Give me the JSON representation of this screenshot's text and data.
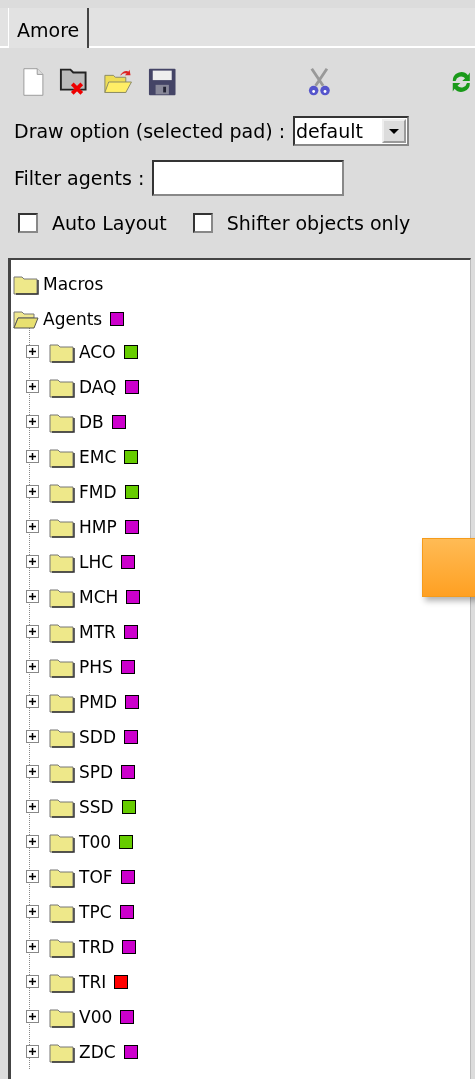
{
  "tabs": [
    {
      "label": "Amore"
    }
  ],
  "draw_option": {
    "label": "Draw option (selected pad) :",
    "value": "default"
  },
  "filter": {
    "label": "Filter agents :"
  },
  "checkboxes": [
    {
      "label": "Auto Layout",
      "checked": false
    },
    {
      "label": "Shifter objects only",
      "checked": false
    }
  ],
  "tree": [
    {
      "label": "Macros",
      "expanded": false
    },
    {
      "label": "Agents",
      "expanded": true,
      "color": "#cc00cc",
      "children": [
        {
          "label": "ACO",
          "expanded": false,
          "color": "#66cc00"
        },
        {
          "label": "DAQ",
          "expanded": false,
          "color": "#cc00cc"
        },
        {
          "label": "DB",
          "expanded": false,
          "color": "#cc00cc"
        },
        {
          "label": "EMC",
          "expanded": false,
          "color": "#66cc00"
        },
        {
          "label": "FMD",
          "expanded": false,
          "color": "#66cc00"
        },
        {
          "label": "HMP",
          "expanded": false,
          "color": "#cc00cc"
        },
        {
          "label": "LHC",
          "expanded": false,
          "color": "#cc00cc"
        },
        {
          "label": "MCH",
          "expanded": false,
          "color": "#cc00cc"
        },
        {
          "label": "MTR",
          "expanded": false,
          "color": "#cc00cc"
        },
        {
          "label": "PHS",
          "expanded": false,
          "color": "#cc00cc"
        },
        {
          "label": "PMD",
          "expanded": false,
          "color": "#cc00cc"
        },
        {
          "label": "SDD",
          "expanded": false,
          "color": "#cc00cc"
        },
        {
          "label": "SPD",
          "expanded": false,
          "color": "#cc00cc"
        },
        {
          "label": "SSD",
          "expanded": false,
          "color": "#66cc00"
        },
        {
          "label": "T00",
          "expanded": false,
          "color": "#66cc00"
        },
        {
          "label": "TOF",
          "expanded": false,
          "color": "#cc00cc"
        },
        {
          "label": "TPC",
          "expanded": false,
          "color": "#cc00cc"
        },
        {
          "label": "TRD",
          "expanded": false,
          "color": "#cc00cc"
        },
        {
          "label": "TRI",
          "expanded": false,
          "color": "#ff0000"
        },
        {
          "label": "V00",
          "expanded": false,
          "color": "#cc00cc"
        },
        {
          "label": "ZDC",
          "expanded": false,
          "color": "#cc00cc"
        }
      ]
    }
  ]
}
